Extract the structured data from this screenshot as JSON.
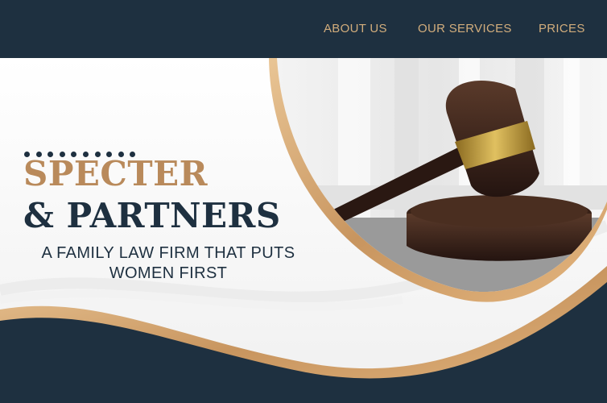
{
  "nav": {
    "about": "ABOUT US",
    "services": "OUR SERVICES",
    "prices": "PRICES"
  },
  "hero": {
    "brand_line1": "SPECTER",
    "brand_line2": "& PARTNERS",
    "tagline_line1": "A FAMILY LAW FIRM THAT PUTS",
    "tagline_line2": "WOMEN FIRST",
    "image": "gavel-on-sound-block-photo"
  },
  "colors": {
    "navy": "#1e3040",
    "gold": "#d2ad7c",
    "brand_gold": "#b98a5b",
    "white": "#ffffff"
  }
}
